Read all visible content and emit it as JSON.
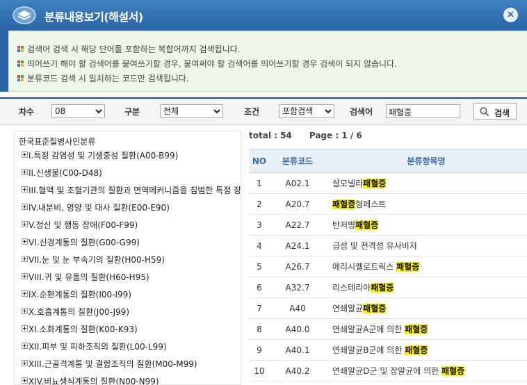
{
  "window": {
    "title": "분류내용보기(해설서)",
    "close_label": "×"
  },
  "notice": [
    "검색어 검색 시 해당 단어를 포함하는 복합어까지 검색됩니다.",
    "띄어쓰기 해야 할 검색어를 붙여쓰기할 경우, 붙여써야 할 검색어를 띄어쓰기할 경우 검색이 되지 않습니다.",
    "분류코드 검색 시 일치하는 코드만 검색됩니다."
  ],
  "search": {
    "edition_label": "차수",
    "edition_value": "08",
    "type_label": "구분",
    "type_value": "전체",
    "condition_label": "조건",
    "condition_value": "포함검색",
    "keyword_label": "검색어",
    "keyword_value": "패혈증",
    "button_label": "검색"
  },
  "tree": {
    "root": "한국표준질병사인분류",
    "items": [
      "I.특정 감염성 및 기생충성 질환(A00-B99)",
      "II.신생물(C00-D48)",
      "III.혈액 및 조혈기관의 질환과 면역메커니즘을 침범한 특정 장",
      "IV.내분비, 영양 및 대사 질환(E00-E90)",
      "V.정신 및 행동 장애(F00-F99)",
      "VI.신경계통의 질환(G00-G99)",
      "VII.눈 및 눈 부속기의 질환(H00-H59)",
      "VIII.귀 및 유돌의 질환(H60-H95)",
      "IX.순환계통의 질환(I00-I99)",
      "X.호흡계통의 질환(J00-J99)",
      "XI.소화계통의 질환(K00-K93)",
      "XII.피부 및 피하조직의 질환(L00-L99)",
      "XIII.근골격계통 및 결합조직의 질환(M00-M99)",
      "XIV.비뇨생식계통의 질환(N00-N99)"
    ]
  },
  "results": {
    "total_label": "total : 54",
    "page_label": "Page : 1 / 6",
    "headers": {
      "no": "NO",
      "code": "분류코드",
      "name": "분류항목명"
    },
    "rows": [
      {
        "no": "1",
        "code": "A02.1",
        "pre": "살모넬라",
        "hl": "패혈증",
        "post": ""
      },
      {
        "no": "2",
        "code": "A20.7",
        "pre": "",
        "hl": "패혈증",
        "post": "형페스트"
      },
      {
        "no": "3",
        "code": "A22.7",
        "pre": "탄저병",
        "hl": "패혈증",
        "post": ""
      },
      {
        "no": "4",
        "code": "A24.1",
        "pre": "급성 및 전격성 유사비저",
        "hl": "",
        "post": ""
      },
      {
        "no": "5",
        "code": "A26.7",
        "pre": "에리시펠로트릭스 ",
        "hl": "패혈증",
        "post": ""
      },
      {
        "no": "6",
        "code": "A32.7",
        "pre": "리스테리아",
        "hl": "패혈증",
        "post": ""
      },
      {
        "no": "7",
        "code": "A40",
        "pre": "연쇄알균",
        "hl": "패혈증",
        "post": ""
      },
      {
        "no": "8",
        "code": "A40.0",
        "pre": "연쇄알균A군에 의한 ",
        "hl": "패혈증",
        "post": ""
      },
      {
        "no": "9",
        "code": "A40.1",
        "pre": "연쇄알균B군에 의한 ",
        "hl": "패혈증",
        "post": ""
      },
      {
        "no": "10",
        "code": "A40.2",
        "pre": "연쇄알균D군 및 장알균에 의한 ",
        "hl": "패혈증",
        "post": ""
      }
    ]
  },
  "colors": {
    "titlebar": "#2a66a6",
    "highlight": "#fff200",
    "header_text": "#3b6ea8",
    "notice_bg": "#eef5e9"
  },
  "icons": {
    "logo": "book-logo-icon",
    "close": "close-icon",
    "search": "search-icon",
    "bullet": "colored-square-bullet-icon",
    "tree_toggle": "plus-box-icon"
  }
}
